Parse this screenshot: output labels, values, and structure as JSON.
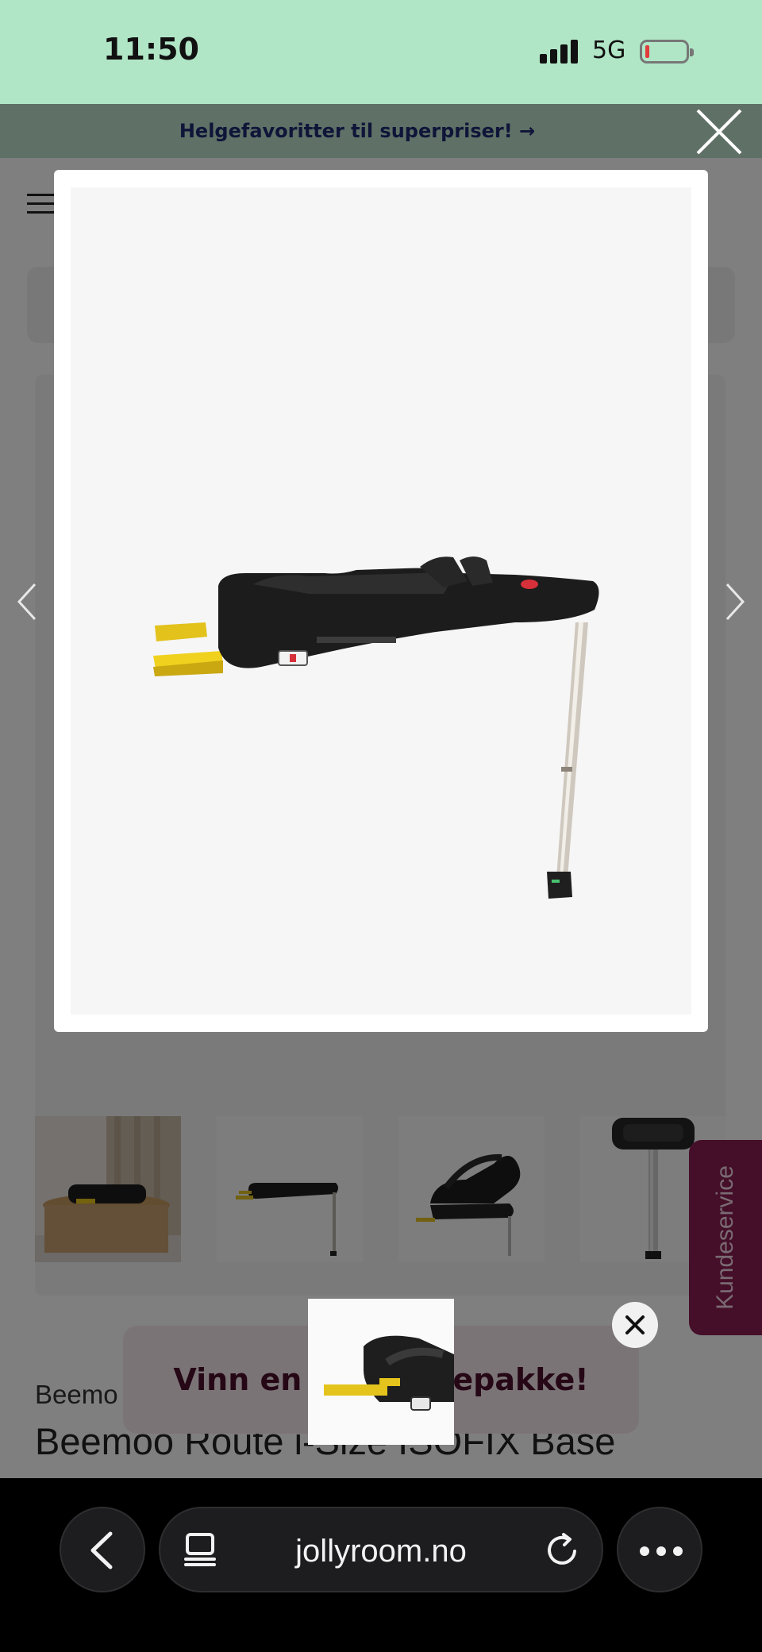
{
  "status_bar": {
    "time": "11:50",
    "network": "5G"
  },
  "promo_bar": {
    "text": "Helgefavoritter til superpriser! →"
  },
  "product": {
    "brand": "Beemo",
    "title": "Beemoo Route i-Size ISOFIX Base"
  },
  "toast": {
    "text": "Vinn en Beemoo-babypakke!",
    "left_text": "Vinn en",
    "right_text": "epakke!"
  },
  "kundeservice": {
    "label": "Kundeservice"
  },
  "browser": {
    "url": "jollyroom.no"
  },
  "colors": {
    "status_bg": "#b0e6c6",
    "accent": "#8a1d52",
    "promo_text": "#1e2a72"
  },
  "icons": [
    "close-icon",
    "chevron-left-icon",
    "chevron-right-icon",
    "back-icon",
    "tabs-icon",
    "reload-icon",
    "more-icon",
    "hamburger-icon"
  ]
}
